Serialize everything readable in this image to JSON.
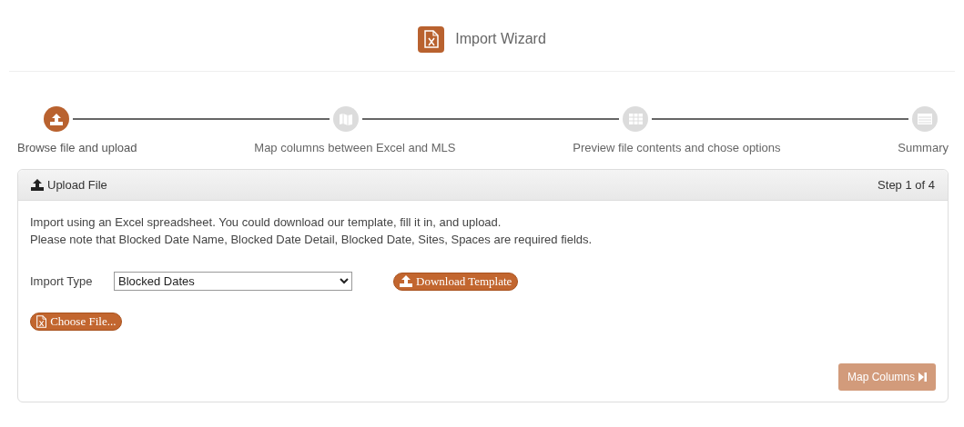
{
  "header": {
    "title": "Import Wizard"
  },
  "steps": [
    {
      "label": "Browse file and upload",
      "selected": true,
      "kind": "upload"
    },
    {
      "label": "Map columns between Excel and MLS",
      "selected": false,
      "kind": "map"
    },
    {
      "label": "Preview file contents and chose options",
      "selected": false,
      "kind": "grid"
    },
    {
      "label": "Summary",
      "selected": false,
      "kind": "list"
    }
  ],
  "panel": {
    "title": "Upload File",
    "step": "Step 1 of 4",
    "intro": [
      "Import using an Excel spreadsheet. You could download our template, fill it in, and upload.",
      "Please note that Blocked Date Name, Blocked Date Detail, Blocked Date, Sites, Spaces are required fields."
    ],
    "import_type": {
      "label": "Import Type",
      "value": "Blocked Dates"
    },
    "download_button": "Download Template",
    "choose_button": "Choose File...",
    "next_button": {
      "label": "Map Columns",
      "disabled": true
    }
  }
}
